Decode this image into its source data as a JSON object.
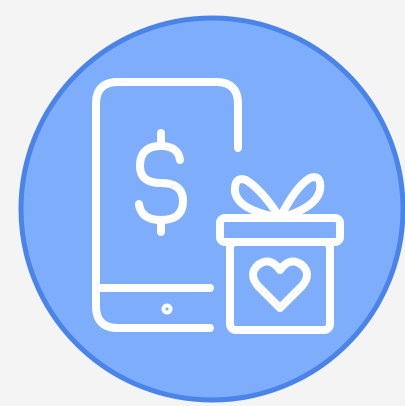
{
  "icon": {
    "name": "mobile-payment-gift-icon",
    "symbol": "$",
    "colors": {
      "background": "#f4f4f4",
      "circle_fill": "#7eaefb",
      "circle_stroke": "#4a84e8",
      "line": "#ffffff"
    }
  }
}
